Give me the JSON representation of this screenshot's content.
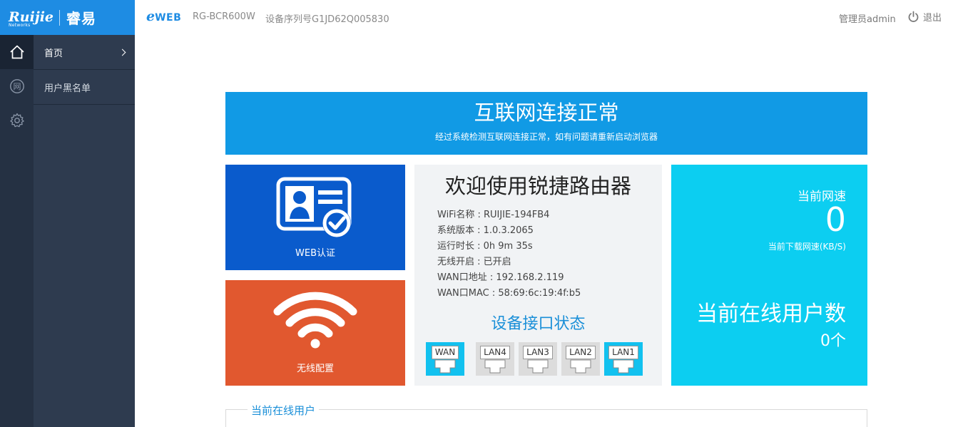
{
  "brand": {
    "logo_text": "Ruijie",
    "logo_sub": "Networks",
    "logo_cn": "睿易",
    "eweb_e": "e",
    "eweb_text": "WEB"
  },
  "topbar": {
    "model": "RG-BCR600W",
    "serial": "设备序列号G1JD62Q005830",
    "admin": "管理员admin",
    "logout": "退出"
  },
  "rail": {
    "items": [
      {
        "icon": "home-icon",
        "active": true
      },
      {
        "icon": "network-icon",
        "glyph": "网",
        "active": false
      },
      {
        "icon": "gear-icon",
        "active": false
      }
    ]
  },
  "submenu": {
    "items": [
      {
        "label": "首页"
      },
      {
        "label": "用户黑名单"
      }
    ]
  },
  "banner": {
    "title": "互联网连接正常",
    "subtitle": "经过系统检测互联网连接正常，如有问题请重新启动浏览器"
  },
  "tiles": {
    "web_auth": "WEB认证",
    "wireless": "无线配置"
  },
  "info": {
    "title": "欢迎使用锐捷路由器",
    "rows": [
      "WiFi名称 : RUIJIE-194FB4",
      "系统版本 : 1.0.3.2065",
      "运行时长 : 0h 9m 35s",
      "无线开启 : 已开启",
      "WAN口地址 : 192.168.2.119",
      "WAN口MAC : 58:69:6c:19:4f:b5"
    ],
    "interface_title": "设备接口状态",
    "ports": [
      {
        "label": "WAN",
        "status": "up"
      },
      {
        "label": "LAN4",
        "status": "down"
      },
      {
        "label": "LAN3",
        "status": "down"
      },
      {
        "label": "LAN2",
        "status": "down"
      },
      {
        "label": "LAN1",
        "status": "up"
      }
    ]
  },
  "stats": {
    "speed_label": "当前网速",
    "speed_value": "0",
    "speed_sub": "当前下载网速(KB/S)",
    "users_label": "当前在线用户数",
    "users_value": "0个"
  },
  "online": {
    "title": "当前在线用户"
  },
  "colors": {
    "brand_blue": "#1e8ce3",
    "banner_blue": "#119ae5",
    "web_tile": "#0a5bcc",
    "wifi_tile": "#e1582f",
    "stats_tile": "#0ccef1",
    "port_up": "#12c1ef",
    "port_down": "#dcdcdc",
    "sidebar_rail": "#253143",
    "sidebar_menu": "#2e3b4f"
  }
}
